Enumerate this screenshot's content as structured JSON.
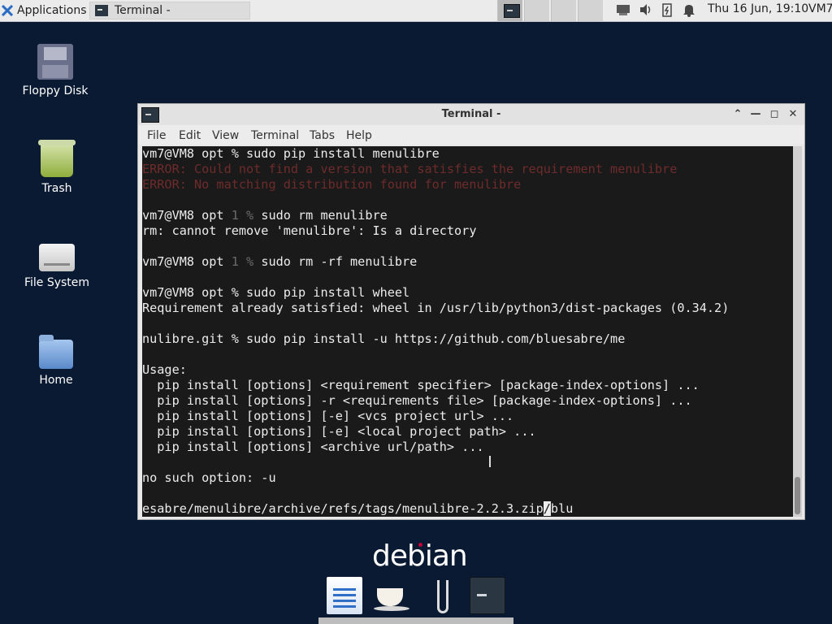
{
  "top_panel": {
    "applications_label": "Applications",
    "task_title": "Terminal -",
    "clock": "Thu 16 Jun, 19:10",
    "user": "VM7"
  },
  "desktop": {
    "icons": [
      {
        "label": "Floppy Disk"
      },
      {
        "label": "Trash"
      },
      {
        "label": "File System"
      },
      {
        "label": "Home"
      }
    ],
    "logo_text": "debian"
  },
  "window": {
    "title": "Terminal -",
    "menu": [
      "File",
      "Edit",
      "View",
      "Terminal",
      "Tabs",
      "Help"
    ]
  },
  "terminal": {
    "l1_prompt": "vm7@VM8 opt % ",
    "l1_cmd": "sudo pip install menulibre",
    "l2": "ERROR: Could not find a version that satisfies the requirement menulibre",
    "l3": "ERROR: No matching distribution found for menulibre",
    "l5_prompt": "vm7@VM8 opt ",
    "l5_code": "1 % ",
    "l5_cmd": "sudo rm menulibre",
    "l6": "rm: cannot remove 'menulibre': Is a directory",
    "l8_prompt": "vm7@VM8 opt ",
    "l8_code": "1 % ",
    "l8_cmd": "sudo rm -rf menulibre",
    "l10_prompt": "vm7@VM8 opt % ",
    "l10_cmd": "sudo pip install wheel",
    "l11": "Requirement already satisfied: wheel in /usr/lib/python3/dist-packages (0.34.2)",
    "l13": "nulibre.git % sudo pip install -u https://github.com/bluesabre/me",
    "l15": "Usage:",
    "l16": "  pip install [options] <requirement specifier> [package-index-options] ...",
    "l17": "  pip install [options] -r <requirements file> [package-index-options] ...",
    "l18": "  pip install [options] [-e] <vcs project url> ...",
    "l19": "  pip install [options] [-e] <local project path> ...",
    "l20": "  pip install [options] <archive url/path> ...",
    "l22": "no such option: -u",
    "l24_before": "esabre/menulibre/archive/refs/tags/menulibre-2.2.3.zip",
    "l24_cursor": "/",
    "l24_after": "blu"
  }
}
